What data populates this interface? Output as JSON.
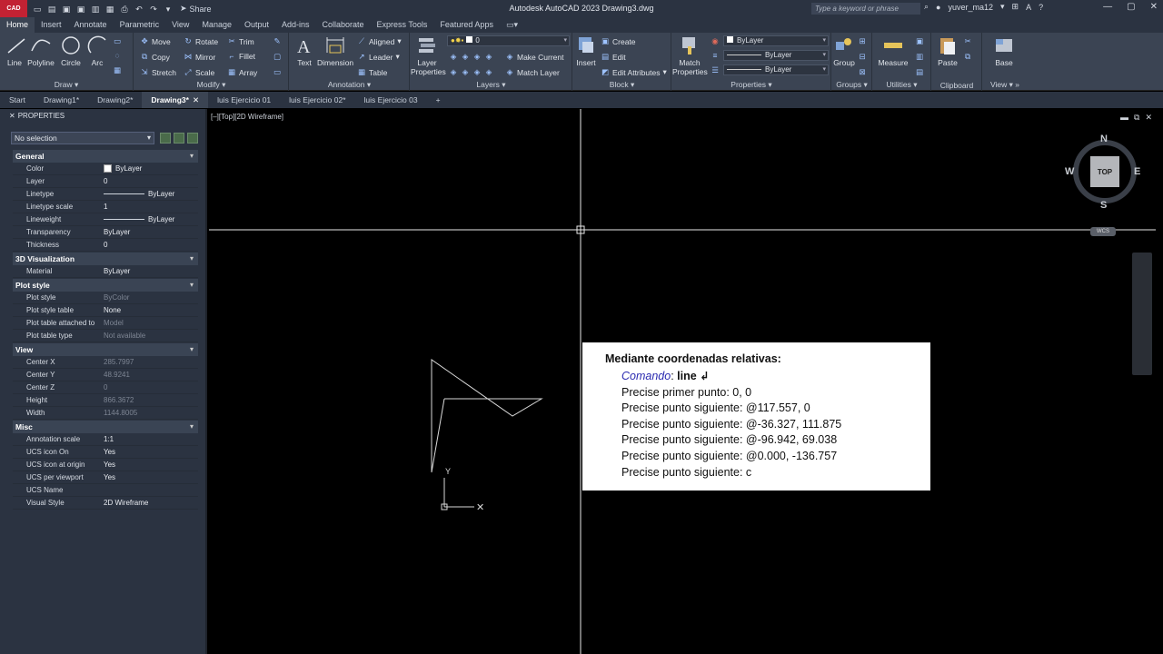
{
  "titlebar": {
    "app_badge": "CAD",
    "share": "Share",
    "title": "Autodesk AutoCAD 2023   Drawing3.dwg",
    "search_placeholder": "Type a keyword or phrase",
    "user": "yuver_ma12"
  },
  "ribbon_tabs": [
    "Home",
    "Insert",
    "Annotate",
    "Parametric",
    "View",
    "Manage",
    "Output",
    "Add-ins",
    "Collaborate",
    "Express Tools",
    "Featured Apps"
  ],
  "ribbon": {
    "draw": {
      "label": "Draw",
      "line": "Line",
      "polyline": "Polyline",
      "circle": "Circle",
      "arc": "Arc"
    },
    "modify": {
      "label": "Modify",
      "move": "Move",
      "rotate": "Rotate",
      "trim": "Trim",
      "copy": "Copy",
      "mirror": "Mirror",
      "fillet": "Fillet",
      "stretch": "Stretch",
      "scale": "Scale",
      "array": "Array"
    },
    "annotation": {
      "label": "Annotation",
      "text": "Text",
      "dimension": "Dimension",
      "aligned": "Aligned",
      "leader": "Leader",
      "table": "Table"
    },
    "layers": {
      "label": "Layers",
      "layer_properties": "Layer Properties",
      "current_layer": "0",
      "make_current": "Make Current",
      "match_layer": "Match Layer"
    },
    "block": {
      "label": "Block",
      "insert": "Insert",
      "create": "Create",
      "edit": "Edit",
      "edit_attributes": "Edit Attributes"
    },
    "properties": {
      "label": "Properties",
      "match_properties": "Match Properties",
      "color": "ByLayer",
      "linetype": "ByLayer",
      "lineweight": "ByLayer"
    },
    "groups": {
      "label": "Groups",
      "group": "Group"
    },
    "utilities": {
      "label": "Utilities",
      "measure": "Measure"
    },
    "clipboard": {
      "label": "Clipboard",
      "paste": "Paste"
    },
    "view": {
      "label": "View",
      "base": "Base"
    }
  },
  "doc_tabs": [
    "Start",
    "Drawing1*",
    "Drawing2*",
    "Drawing3*",
    "luis Ejercicio 01",
    "luis Ejercicio 02*",
    "luis Ejercicio 03"
  ],
  "properties": {
    "title": "PROPERTIES",
    "selection": "No selection",
    "sections": [
      {
        "name": "General",
        "rows": [
          {
            "k": "Color",
            "v": "ByLayer",
            "swatch": true
          },
          {
            "k": "Layer",
            "v": "0"
          },
          {
            "k": "Linetype",
            "v": "ByLayer",
            "line": true
          },
          {
            "k": "Linetype scale",
            "v": "1"
          },
          {
            "k": "Lineweight",
            "v": "ByLayer",
            "line": true
          },
          {
            "k": "Transparency",
            "v": "ByLayer"
          },
          {
            "k": "Thickness",
            "v": "0"
          }
        ]
      },
      {
        "name": "3D Visualization",
        "rows": [
          {
            "k": "Material",
            "v": "ByLayer"
          }
        ]
      },
      {
        "name": "Plot style",
        "rows": [
          {
            "k": "Plot style",
            "v": "ByColor",
            "dim": true
          },
          {
            "k": "Plot style table",
            "v": "None"
          },
          {
            "k": "Plot table attached to",
            "v": "Model",
            "dim": true
          },
          {
            "k": "Plot table type",
            "v": "Not available",
            "dim": true
          }
        ]
      },
      {
        "name": "View",
        "rows": [
          {
            "k": "Center X",
            "v": "285.7997",
            "dim": true
          },
          {
            "k": "Center Y",
            "v": "48.9241",
            "dim": true
          },
          {
            "k": "Center Z",
            "v": "0",
            "dim": true
          },
          {
            "k": "Height",
            "v": "866.3672",
            "dim": true
          },
          {
            "k": "Width",
            "v": "1144.8005",
            "dim": true
          }
        ]
      },
      {
        "name": "Misc",
        "rows": [
          {
            "k": "Annotation scale",
            "v": "1:1"
          },
          {
            "k": "UCS icon On",
            "v": "Yes"
          },
          {
            "k": "UCS icon at origin",
            "v": "Yes"
          },
          {
            "k": "UCS per viewport",
            "v": "Yes"
          },
          {
            "k": "UCS Name",
            "v": ""
          },
          {
            "k": "Visual Style",
            "v": "2D Wireframe"
          }
        ]
      }
    ]
  },
  "canvas": {
    "view_label": "[–][Top][2D Wireframe]",
    "viewcube": {
      "top": "TOP",
      "n": "N",
      "s": "S",
      "e": "E",
      "w": "W"
    },
    "wcs": "WCS",
    "ucs_y": "Y"
  },
  "note": {
    "title": "Mediante coordenadas relativas:",
    "command_label": "Comando",
    "command_value": "line ↲",
    "lines": [
      "Precise primer punto: 0, 0",
      "Precise punto siguiente: @117.557, 0",
      "Precise punto siguiente: @-36.327, 111.875",
      "Precise punto siguiente: @-96.942, 69.038",
      "Precise punto siguiente: @0.000, -136.757",
      "Precise punto siguiente: c"
    ]
  }
}
